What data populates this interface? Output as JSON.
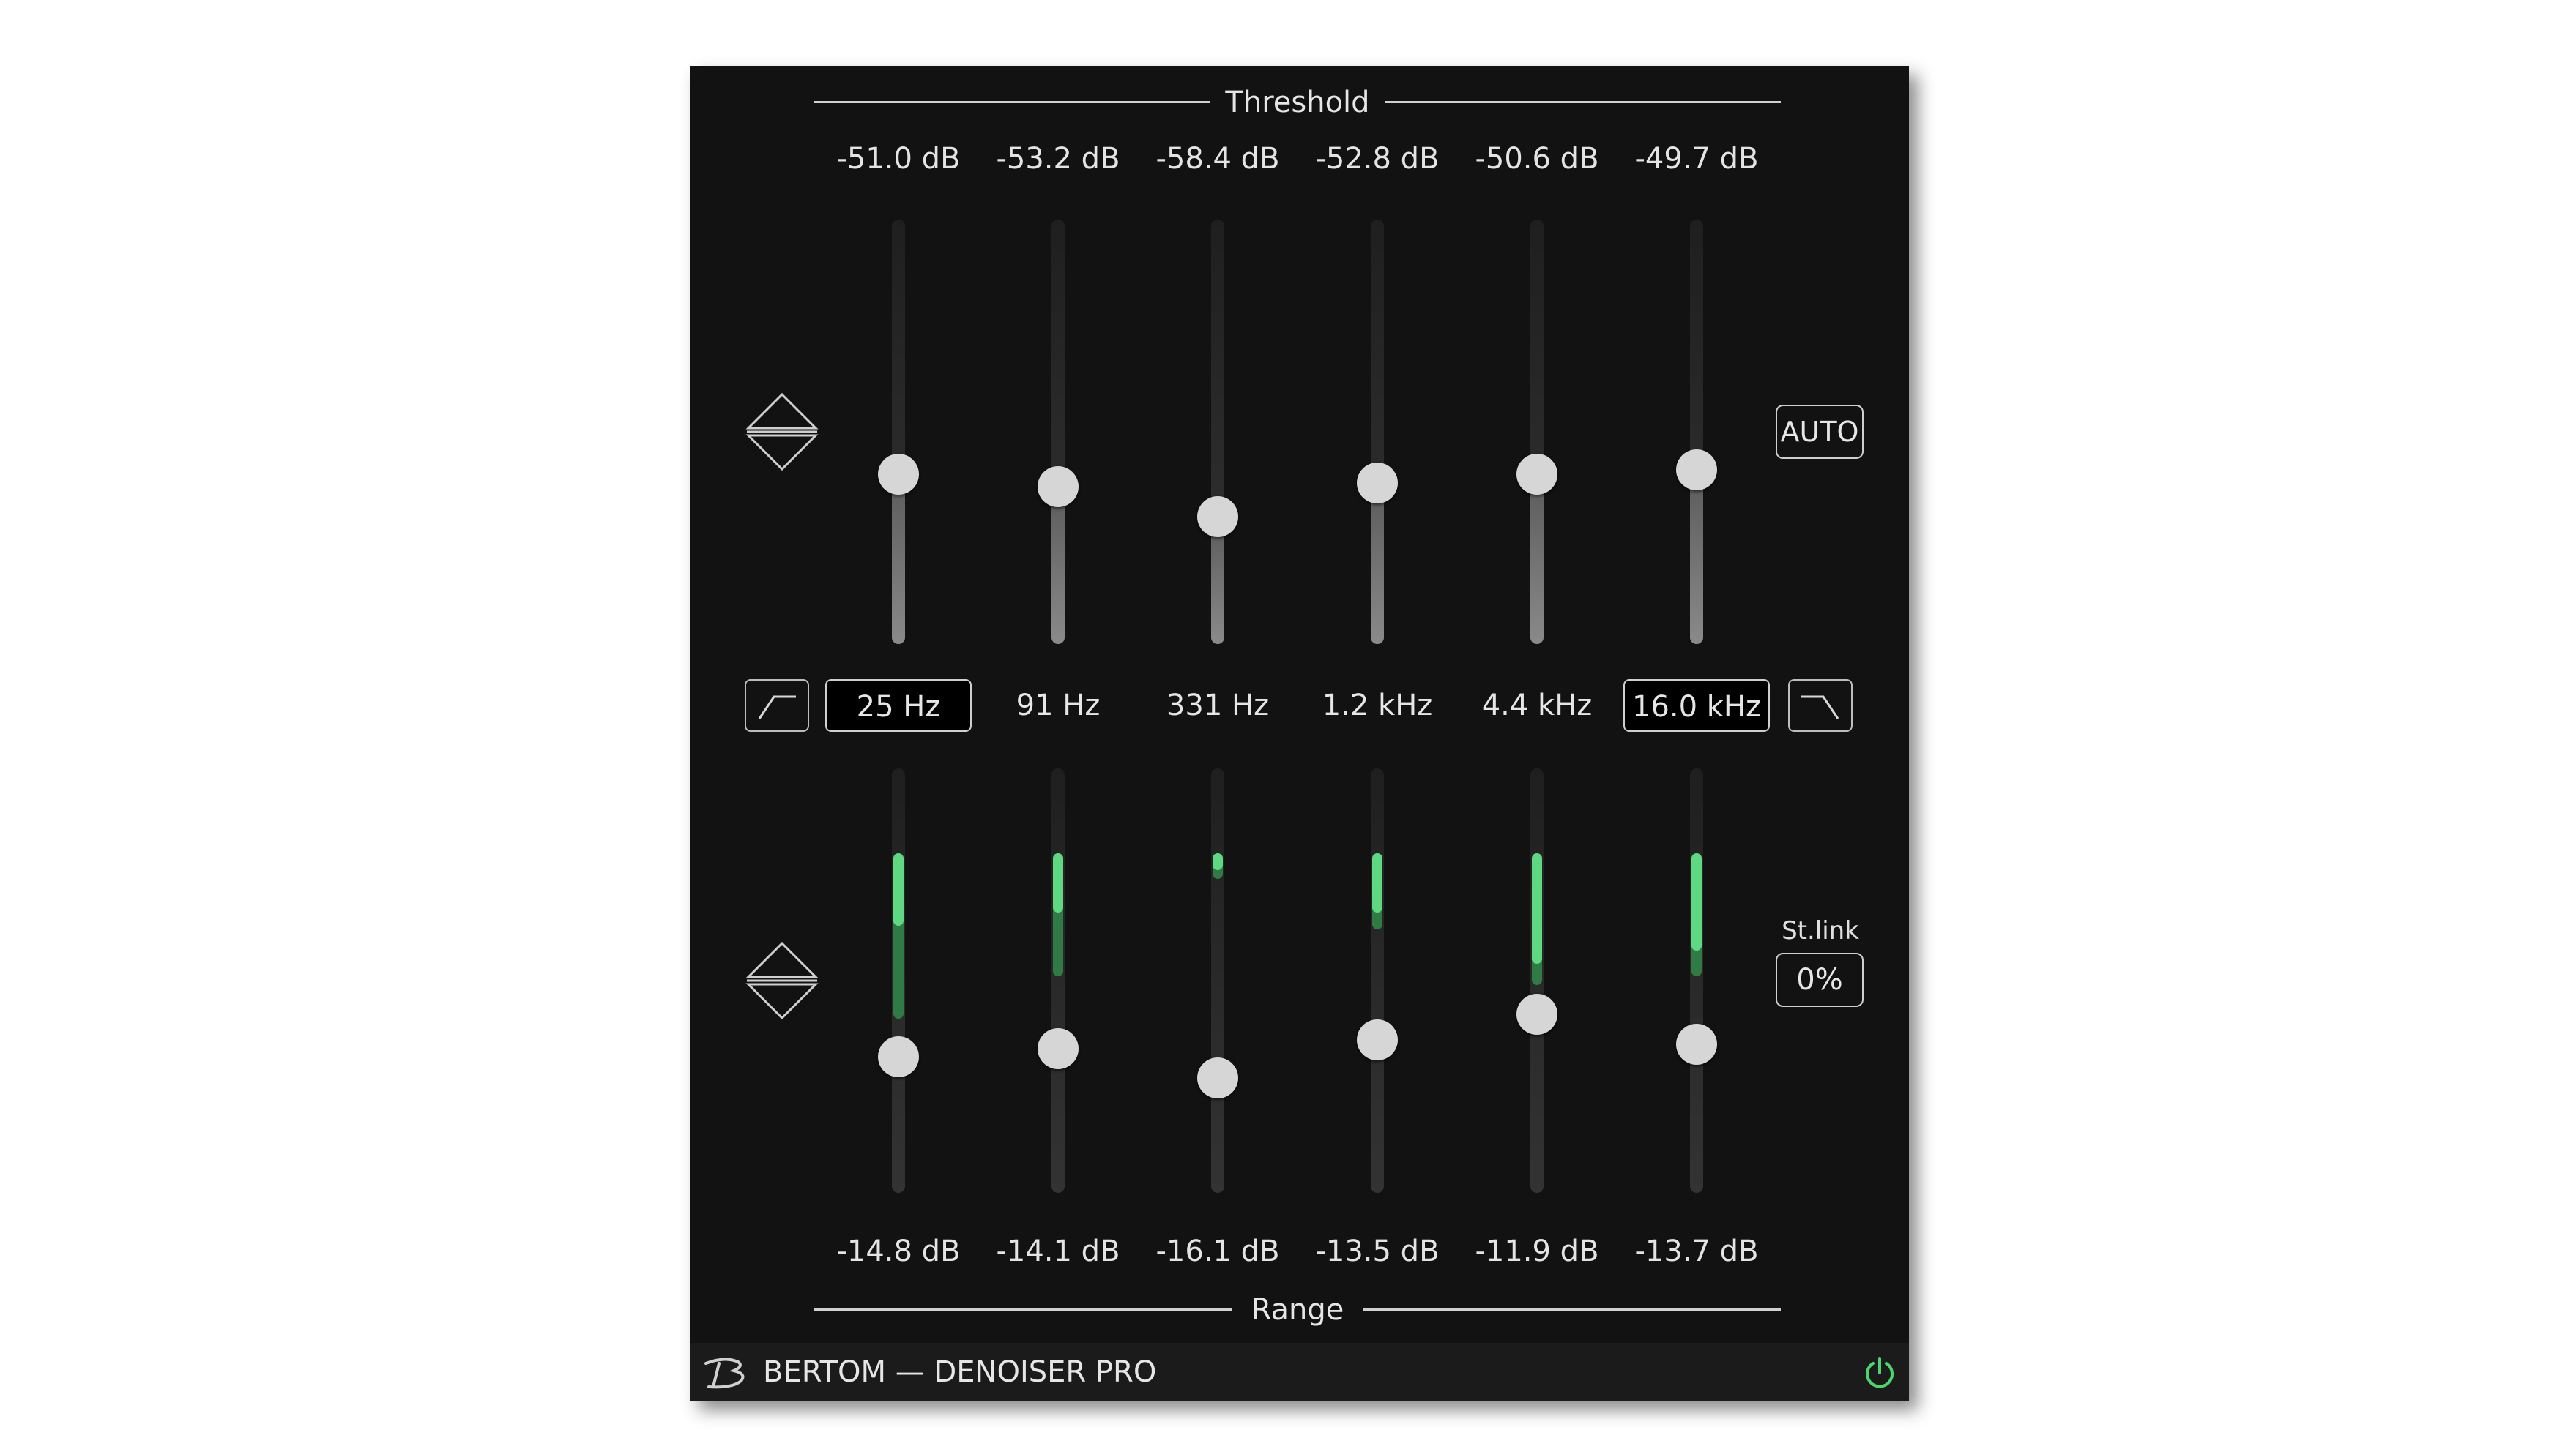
{
  "threshold": {
    "title": "Threshold",
    "bands": [
      {
        "value": "-51.0 dB",
        "level": 0.4
      },
      {
        "value": "-53.2 dB",
        "level": 0.37
      },
      {
        "value": "-58.4 dB",
        "level": 0.3
      },
      {
        "value": "-52.8 dB",
        "level": 0.38
      },
      {
        "value": "-50.6 dB",
        "level": 0.4
      },
      {
        "value": "-49.7 dB",
        "level": 0.41
      }
    ]
  },
  "frequencies": [
    {
      "label": "25 Hz",
      "boxed": true
    },
    {
      "label": "91 Hz",
      "boxed": false
    },
    {
      "label": "331 Hz",
      "boxed": false
    },
    {
      "label": "1.2 kHz",
      "boxed": false
    },
    {
      "label": "4.4 kHz",
      "boxed": false
    },
    {
      "label": "16.0 kHz",
      "boxed": true
    }
  ],
  "range": {
    "title": "Range",
    "bands": [
      {
        "value": "-14.8 dB",
        "level": 0.32,
        "meter_top": 0.2,
        "meter_bright": 0.17,
        "meter_dim": 0.39
      },
      {
        "value": "-14.1 dB",
        "level": 0.34,
        "meter_top": 0.2,
        "meter_bright": 0.14,
        "meter_dim": 0.29
      },
      {
        "value": "-16.1 dB",
        "level": 0.27,
        "meter_top": 0.2,
        "meter_bright": 0.04,
        "meter_dim": 0.06
      },
      {
        "value": "-13.5 dB",
        "level": 0.36,
        "meter_top": 0.2,
        "meter_bright": 0.14,
        "meter_dim": 0.18
      },
      {
        "value": "-11.9 dB",
        "level": 0.42,
        "meter_top": 0.2,
        "meter_bright": 0.26,
        "meter_dim": 0.31
      },
      {
        "value": "-13.7 dB",
        "level": 0.35,
        "meter_top": 0.2,
        "meter_bright": 0.23,
        "meter_dim": 0.29
      }
    ]
  },
  "buttons": {
    "auto_label": "AUTO",
    "stlink_label": "St.link",
    "stlink_value": "0%"
  },
  "footer": {
    "brand": "BERTOM — DENOISER PRO"
  },
  "colors": {
    "panel": "#121212",
    "meter_green": "#5fd882",
    "power_green": "#4cd46e"
  }
}
